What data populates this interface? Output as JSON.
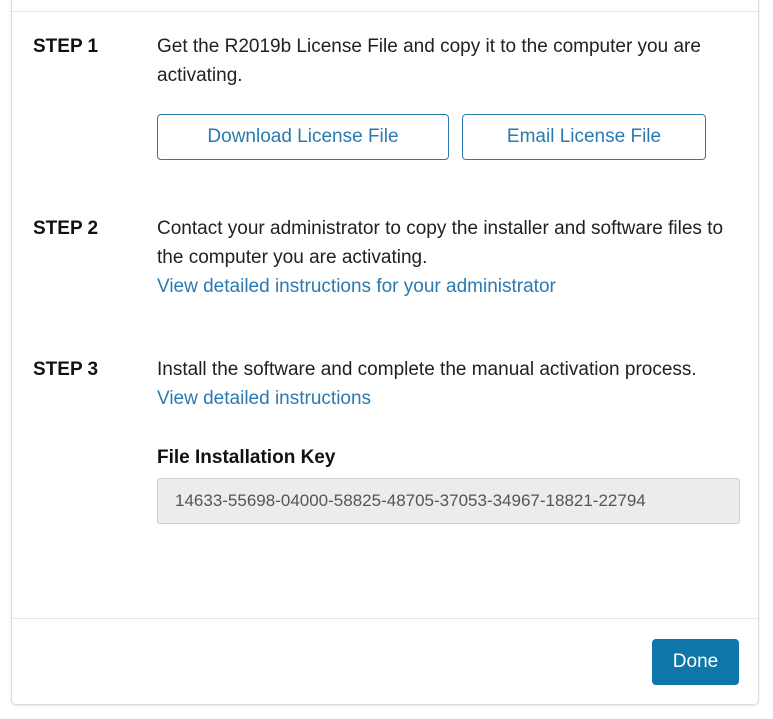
{
  "steps": [
    {
      "label": "STEP 1",
      "text": "Get the R2019b License File and copy it to the computer you are activating.",
      "buttons": {
        "download": "Download License File",
        "email": "Email License File"
      }
    },
    {
      "label": "STEP 2",
      "text": "Contact your administrator to copy the installer and software files to the computer you are activating.",
      "link": "View detailed instructions for your administrator"
    },
    {
      "label": "STEP 3",
      "text": "Install the software and complete the manual activation process.",
      "link": "View detailed instructions",
      "key_label": "File Installation Key",
      "key_value": "14633-55698-04000-58825-48705-37053-34967-18821-22794"
    }
  ],
  "footer": {
    "done_label": "Done"
  },
  "colors": {
    "accent": "#2a7ab0",
    "primary_button": "#0e76a8",
    "input_background": "#ececec"
  }
}
